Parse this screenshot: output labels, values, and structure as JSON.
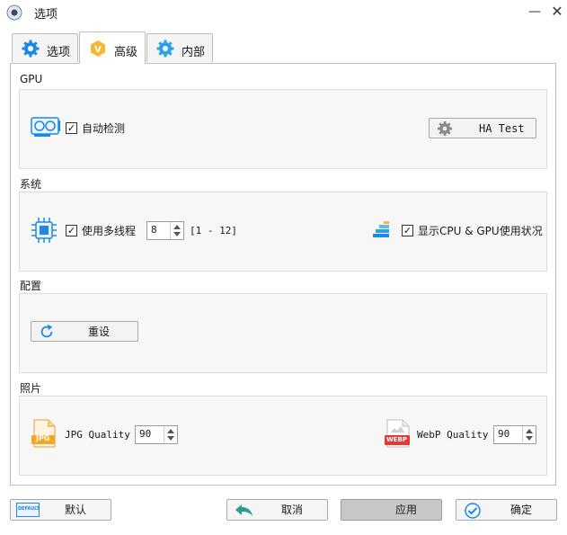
{
  "window": {
    "title": "选项",
    "minimize_glyph": "—",
    "close_glyph": "✕"
  },
  "tabs": [
    {
      "label": "选项",
      "icon": "gear-icon",
      "active": false
    },
    {
      "label": "高级",
      "icon": "v-badge-icon",
      "active": true
    },
    {
      "label": "内部",
      "icon": "gear-icon",
      "active": false
    }
  ],
  "gpu": {
    "label": "GPU",
    "auto_detect_label": "自动检测",
    "auto_detect_checked": true,
    "ha_test_label": "HA Test"
  },
  "system": {
    "label": "系统",
    "multithread_label": "使用多线程",
    "multithread_checked": true,
    "threads_value": "8",
    "range_text": "[1 - 12]",
    "show_usage_label": "显示CPU & GPU使用状况",
    "show_usage_checked": true
  },
  "config": {
    "label": "配置",
    "reset_label": "重设"
  },
  "photo": {
    "label": "照片",
    "jpg_label": "JPG Quality",
    "jpg_value": "90",
    "jpg_badge": "JPG",
    "webp_label": "WebP Quality",
    "webp_value": "90",
    "webp_badge": "WEBP"
  },
  "footer": {
    "default_label": "默认",
    "default_icon_text": "DEFAULT",
    "cancel_label": "取消",
    "apply_label": "应用",
    "ok_label": "确定"
  },
  "colors": {
    "accent_blue": "#1e88e5",
    "jpg_orange": "#f5a623",
    "webp_red": "#e53935"
  }
}
